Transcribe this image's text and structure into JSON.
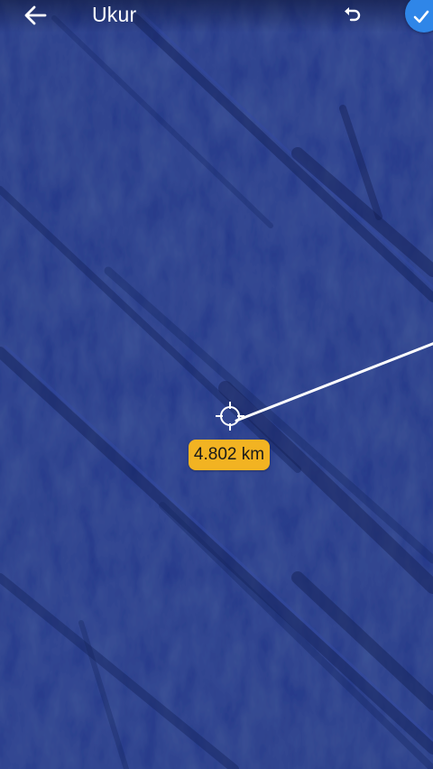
{
  "header": {
    "title": "Ukur",
    "back_icon": "arrow-left-icon",
    "undo_icon": "undo-icon",
    "done_icon": "check-icon"
  },
  "measurement": {
    "distance": "4.802 km"
  },
  "colors": {
    "map_base": "#1e3179",
    "measure_line": "#ffffff",
    "distance_badge": "#f2b322",
    "done_button": "#2f86e8"
  }
}
